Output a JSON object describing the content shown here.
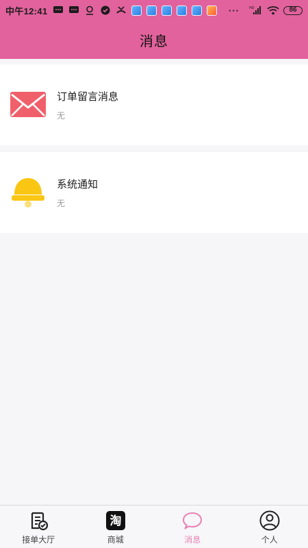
{
  "status_bar": {
    "time": "中午12:41",
    "battery": "86",
    "signal_label": "HD",
    "overflow": "···"
  },
  "header": {
    "title": "消息"
  },
  "cards": [
    {
      "title": "订单留言消息",
      "subtitle": "无",
      "icon": "envelope-icon"
    },
    {
      "title": "系统通知",
      "subtitle": "无",
      "icon": "bell-icon"
    }
  ],
  "bottom_nav": {
    "items": [
      {
        "label": "接单大厅",
        "icon": "order-hall-icon",
        "active": false
      },
      {
        "label": "商城",
        "icon": "taobao-shop-icon",
        "icon_text": "淘",
        "active": false
      },
      {
        "label": "消息",
        "icon": "chat-bubble-icon",
        "active": true
      },
      {
        "label": "个人",
        "icon": "user-profile-icon",
        "active": false
      }
    ]
  },
  "colors": {
    "header": "#e1629c",
    "background": "#f6f5f8",
    "active_tab": "#e881b4",
    "envelope": "#f0606a",
    "bell": "#f9c614"
  }
}
